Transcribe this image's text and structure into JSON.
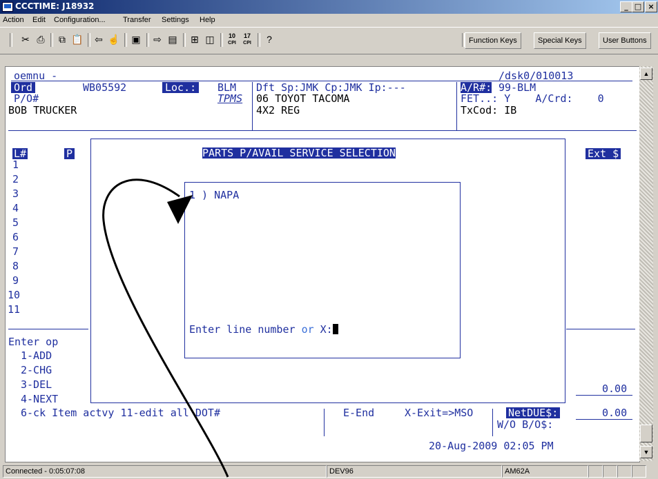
{
  "window": {
    "title": "CCCTIME: J18932"
  },
  "menu": [
    "Action",
    "Edit",
    "Configuration...",
    "Transfer",
    "Settings",
    "Help"
  ],
  "toolbar": {
    "icons": [
      "scissors-icon",
      "print-icon",
      "copy-icon",
      "paste-icon",
      "back-arrow-icon",
      "hand-icon",
      "properties-icon",
      "send-icon",
      "receive-icon",
      "zoom-icon",
      "window-icon",
      "10-cpi-icon",
      "17-cpi-icon",
      "help-icon"
    ],
    "cpi10": "10",
    "cpi17": "17",
    "cpi_label": "CPI",
    "buttons": [
      "Function Keys",
      "Special Keys",
      "User Buttons"
    ]
  },
  "terminal": {
    "header": {
      "program": "oemnu -",
      "path": "/dsk0/010013",
      "ord_label": "Ord",
      "ord_value": "WB05592",
      "loc_label": "Loc.:",
      "loc_value": "BLM",
      "tpms": "TPMS",
      "po_label": "P/O#",
      "customer": "BOB TRUCKER",
      "dft_line": "Dft Sp:JMK Cp:JMK Ip:---",
      "vehicle": "06 TOYOT TACOMA",
      "vehicle2": "4X2 REG",
      "ar_label": "A/R#:",
      "ar_value": "99-BLM",
      "fet_line": "FET..: Y    A/Crd:    0",
      "txcod": "TxCod: IB"
    },
    "columns": {
      "line": "L#",
      "p": "P",
      "ext": "Ext $"
    },
    "line_numbers": [
      "1",
      "2",
      "3",
      "4",
      "5",
      "6",
      "7",
      "8",
      "9",
      "10",
      "11"
    ],
    "dialog": {
      "title": "PARTS P/AVAIL SERVICE SELECTION",
      "option": "1 ) NAPA",
      "prompt_a": "Enter line number ",
      "prompt_or": "or",
      "prompt_b": " X:"
    },
    "menu_options": {
      "enter": "Enter op",
      "add": "1-ADD",
      "chg": "2-CHG",
      "del": "3-DEL",
      "next": "4-NEXT",
      "bottom": "6-ck Item actvy 11-edit all DOT#"
    },
    "footer": {
      "end": "E-End",
      "exit": "X-Exit=>MSO",
      "netdue_label": "NetDUE$:",
      "netdue_value": "0.00",
      "ext_total": "0.00",
      "wo": "W/O B/O$:",
      "datetime": "20-Aug-2009 02:05 PM"
    }
  },
  "status": {
    "connected": "Connected - 0:05:07:08",
    "host": "DEV96",
    "term": "AM62A"
  },
  "colors": {
    "terminal_text": "#1f2f9f",
    "background": "#d4d0c8",
    "titlebar": "#0a246a"
  }
}
